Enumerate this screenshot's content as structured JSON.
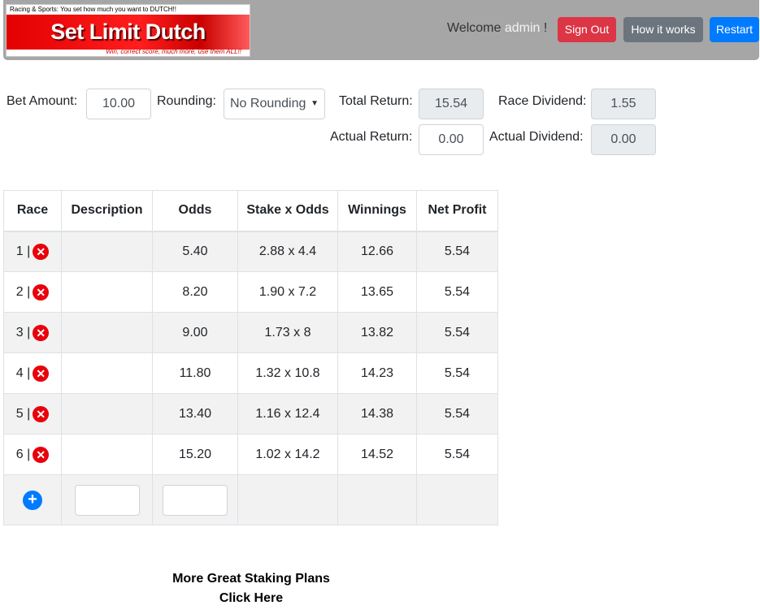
{
  "header": {
    "logo_top_text": "Racing & Sports: You set how much you want to DUTCH!!",
    "logo_title": "Set Limit Dutch",
    "logo_subtitle": "Win, correct score, much more, use them ALL!!",
    "welcome_prefix": "Welcome",
    "username": "admin",
    "welcome_suffix": "!",
    "signout_label": "Sign Out",
    "how_label": "How it works",
    "restart_label": "Restart"
  },
  "form": {
    "bet_amount_label": "Bet Amount:",
    "bet_amount_value": "10.00",
    "rounding_label": "Rounding:",
    "rounding_value": "No Rounding",
    "total_return_label": "Total Return:",
    "total_return_value": "15.54",
    "race_dividend_label": "Race Dividend:",
    "race_dividend_value": "1.55",
    "actual_return_label": "Actual Return:",
    "actual_return_value": "0.00",
    "actual_dividend_label": "Actual Dividend:",
    "actual_dividend_value": "0.00"
  },
  "table": {
    "headers": [
      "Race",
      "Description",
      "Odds",
      "Stake x Odds",
      "Winnings",
      "Net Profit"
    ],
    "rows": [
      {
        "race": "1 |",
        "description": "",
        "odds": "5.40",
        "stake_odds": "2.88 x 4.4",
        "winnings": "12.66",
        "net_profit": "5.54"
      },
      {
        "race": "2 |",
        "description": "",
        "odds": "8.20",
        "stake_odds": "1.90 x 7.2",
        "winnings": "13.65",
        "net_profit": "5.54"
      },
      {
        "race": "3 |",
        "description": "",
        "odds": "9.00",
        "stake_odds": "1.73 x 8",
        "winnings": "13.82",
        "net_profit": "5.54"
      },
      {
        "race": "4 |",
        "description": "",
        "odds": "11.80",
        "stake_odds": "1.32 x 10.8",
        "winnings": "14.23",
        "net_profit": "5.54"
      },
      {
        "race": "5 |",
        "description": "",
        "odds": "13.40",
        "stake_odds": "1.16 x 12.4",
        "winnings": "14.38",
        "net_profit": "5.54"
      },
      {
        "race": "6 |",
        "description": "",
        "odds": "15.20",
        "stake_odds": "1.02 x 14.2",
        "winnings": "14.52",
        "net_profit": "5.54"
      }
    ],
    "new_description_value": "",
    "new_odds_value": ""
  },
  "footer": {
    "more_line1": "More Great Staking Plans",
    "more_line2": "Click Here"
  },
  "icons": {
    "delete": "close-circle-icon",
    "add": "plus-circle-icon",
    "dropdown": "chevron-down-icon"
  },
  "colors": {
    "header_bg": "#a6a6a6",
    "danger": "#dc3545",
    "secondary": "#6c757d",
    "primary": "#007bff",
    "delete_icon": "#e8000b"
  }
}
